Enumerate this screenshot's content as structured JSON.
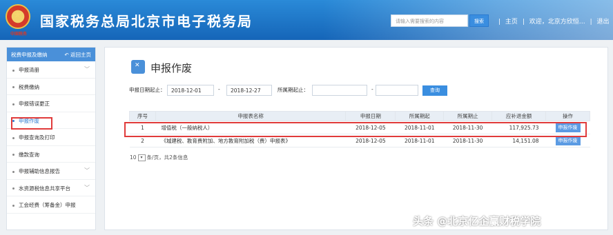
{
  "header": {
    "emblem_caption": "中国税务",
    "site_title": "国家税务总局北京市电子税务局",
    "search_placeholder": "请输入需要搜索的内容",
    "search_button": "搜索",
    "nav_home": "主页",
    "nav_welcome": "欢迎，北京方欣恒…",
    "nav_logout": "退出",
    "sep": "|"
  },
  "sidebar": {
    "header_left": "税费申报及缴纳",
    "header_right": "↶ 返回主页",
    "items": [
      {
        "label": "申报清册",
        "chevron": "﹀"
      },
      {
        "label": "税费缴纳"
      },
      {
        "label": "申报错误更正"
      },
      {
        "label": "申报作废"
      },
      {
        "label": "申报查询及打印"
      },
      {
        "label": "缴款查询"
      },
      {
        "label": "申报辅助信息报告",
        "chevron": "﹀"
      },
      {
        "label": "水资源税信息共享平台",
        "chevron": "﹀"
      },
      {
        "label": "工会经费（筹备金）申报"
      }
    ]
  },
  "main": {
    "title": "申报作废",
    "filter": {
      "date_label": "申报日期起止：",
      "date_from": "2018-12-01",
      "dash": "-",
      "date_to": "2018-12-27",
      "period_label": "所属期起止：",
      "period_from": "",
      "period_to": "",
      "query_button": "查询"
    },
    "table": {
      "headers": [
        "序号",
        "申报表名称",
        "申报日期",
        "所属期起",
        "所属期止",
        "应补退金额",
        "操作"
      ],
      "rows": [
        {
          "no": "1",
          "name": "增值税（一般纳税人）",
          "date": "2018-12-05",
          "from": "2018-11-01",
          "to": "2018-11-30",
          "amount": "117,925.73",
          "action": "申报作废"
        },
        {
          "no": "2",
          "name": "《城建税、教育费附加、地方教育附加税（费）申报表》",
          "date": "2018-12-05",
          "from": "2018-11-01",
          "to": "2018-11-30",
          "amount": "14,151.08",
          "action": "申报作废"
        }
      ]
    },
    "pager": {
      "size": "10",
      "dropdown": "▾",
      "text": "条/页，共2条信息"
    }
  },
  "watermark": "头条 @北京亿企赢财税学院",
  "colors": {
    "accent": "#3a8ee0",
    "highlight": "#e03a3a",
    "header": "#1f74c6"
  }
}
